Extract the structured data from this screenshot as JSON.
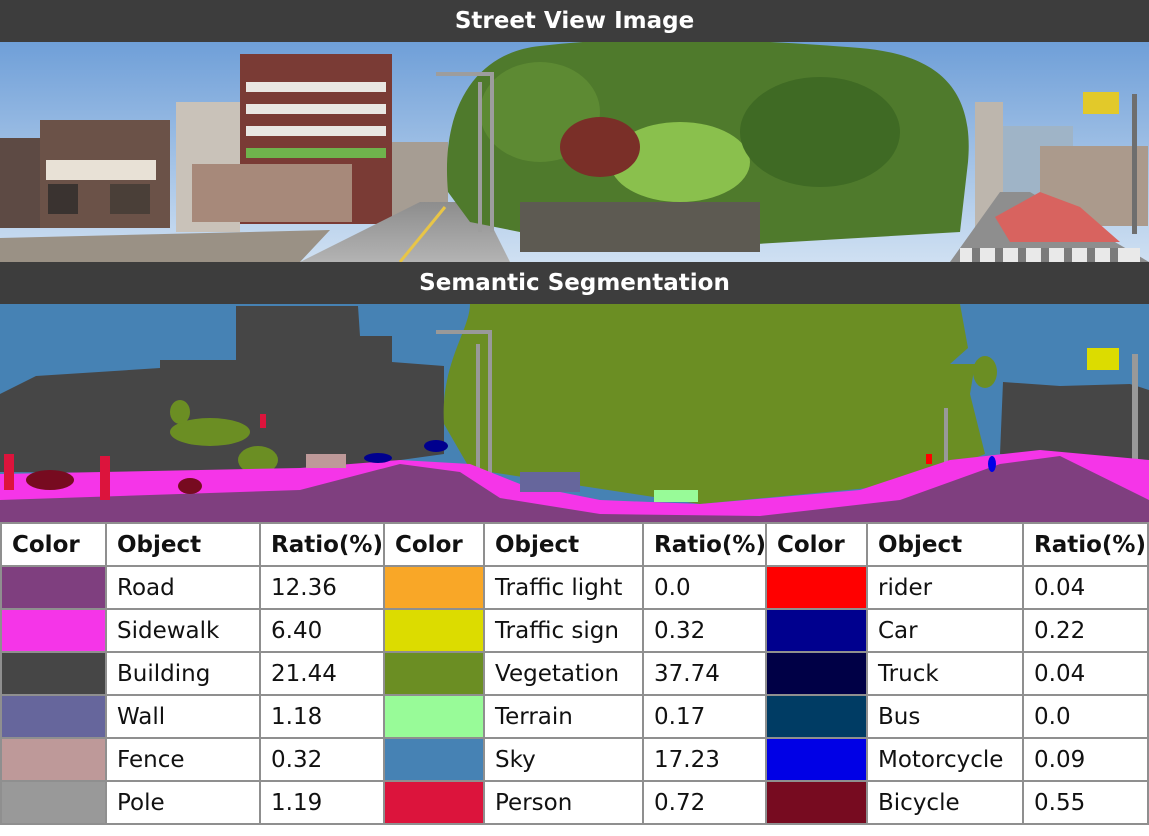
{
  "headings": {
    "street_view": "Street View Image",
    "segmentation": "Semantic Segmentation"
  },
  "table": {
    "headers": [
      "Color",
      "Object",
      "Ratio(%)"
    ],
    "rows": [
      [
        {
          "object": "Road",
          "ratio": "12.36",
          "color": "#7f3f7f"
        },
        {
          "object": "Traffic light",
          "ratio": "0.0",
          "color": "#f9a727"
        },
        {
          "object": "rider",
          "ratio": "0.04",
          "color": "#ff0000"
        }
      ],
      [
        {
          "object": "Sidewalk",
          "ratio": "6.40",
          "color": "#f535e8"
        },
        {
          "object": "Traffic sign",
          "ratio": "0.32",
          "color": "#dcdc00"
        },
        {
          "object": "Car",
          "ratio": "0.22",
          "color": "#00008e"
        }
      ],
      [
        {
          "object": "Building",
          "ratio": "21.44",
          "color": "#464646"
        },
        {
          "object": "Vegetation",
          "ratio": "37.74",
          "color": "#6b8e23"
        },
        {
          "object": "Truck",
          "ratio": "0.04",
          "color": "#000046"
        }
      ],
      [
        {
          "object": "Wall",
          "ratio": "1.18",
          "color": "#66669c"
        },
        {
          "object": "Terrain",
          "ratio": "0.17",
          "color": "#98fb98"
        },
        {
          "object": "Bus",
          "ratio": "0.0",
          "color": "#003c64"
        }
      ],
      [
        {
          "object": "Fence",
          "ratio": "0.32",
          "color": "#be9999"
        },
        {
          "object": "Sky",
          "ratio": "17.23",
          "color": "#4682b4"
        },
        {
          "object": "Motorcycle",
          "ratio": "0.09",
          "color": "#0000e6"
        }
      ],
      [
        {
          "object": "Pole",
          "ratio": "1.19",
          "color": "#999999"
        },
        {
          "object": "Person",
          "ratio": "0.72",
          "color": "#dc143c"
        },
        {
          "object": "Bicycle",
          "ratio": "0.55",
          "color": "#770b20"
        }
      ]
    ]
  }
}
